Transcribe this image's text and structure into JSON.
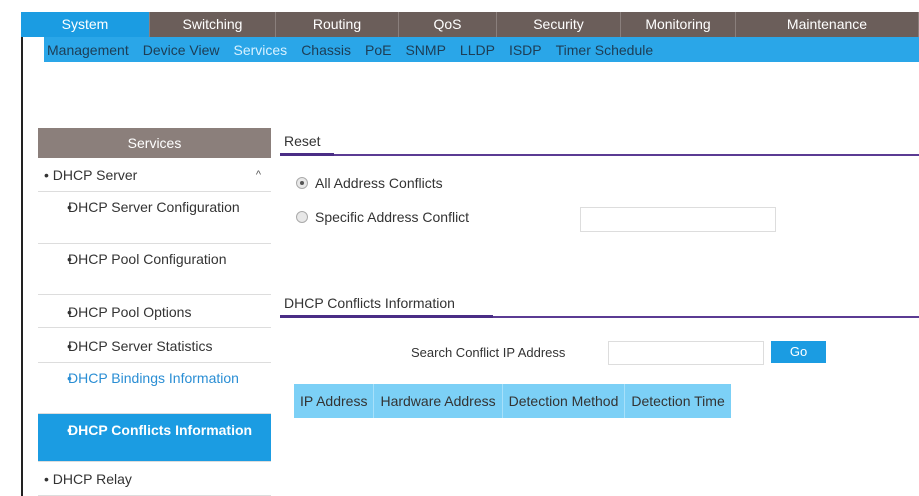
{
  "main_nav": {
    "tabs": [
      {
        "label": "System",
        "active": true
      },
      {
        "label": "Switching",
        "active": false
      },
      {
        "label": "Routing",
        "active": false
      },
      {
        "label": "QoS",
        "active": false
      },
      {
        "label": "Security",
        "active": false
      },
      {
        "label": "Monitoring",
        "active": false
      },
      {
        "label": "Maintenance",
        "active": false
      }
    ]
  },
  "sub_nav": {
    "items": [
      {
        "label": "Management",
        "active": false
      },
      {
        "label": "Device View",
        "active": false
      },
      {
        "label": "Services",
        "active": true
      },
      {
        "label": "Chassis",
        "active": false
      },
      {
        "label": "PoE",
        "active": false
      },
      {
        "label": "SNMP",
        "active": false
      },
      {
        "label": "LLDP",
        "active": false
      },
      {
        "label": "ISDP",
        "active": false
      },
      {
        "label": "Timer Schedule",
        "active": false
      }
    ]
  },
  "sidebar": {
    "header": "Services",
    "items": [
      {
        "label": "DHCP Server",
        "bullet": "•"
      },
      {
        "label": "DHCP Server Configuration",
        "bullet": "•"
      },
      {
        "label": "DHCP Pool Configuration",
        "bullet": "•"
      },
      {
        "label": "DHCP Pool Options",
        "bullet": "•"
      },
      {
        "label": "DHCP Server Statistics",
        "bullet": "•"
      },
      {
        "label": "DHCP Bindings Information",
        "bullet": "•"
      },
      {
        "label": "DHCP Conflicts Information",
        "bullet": "•"
      },
      {
        "label": "DHCP Relay",
        "bullet": "•"
      }
    ],
    "caret": "^"
  },
  "reset": {
    "title": "Reset",
    "option_all": "All Address Conflicts",
    "option_specific": "Specific Address Conflict",
    "selected": "all",
    "specific_value": ""
  },
  "conflicts": {
    "title": "DHCP Conflicts Information",
    "search_label": "Search Conflict IP Address",
    "search_value": "",
    "go_label": "Go",
    "columns": [
      "IP Address",
      "Hardware Address",
      "Detection Method",
      "Detection Time"
    ],
    "rows": []
  },
  "colors": {
    "accent_blue": "#1b9ce2",
    "nav_brown": "#6b5e5a",
    "section_purple": "#5b3b93",
    "table_header": "#7cd0f6"
  }
}
